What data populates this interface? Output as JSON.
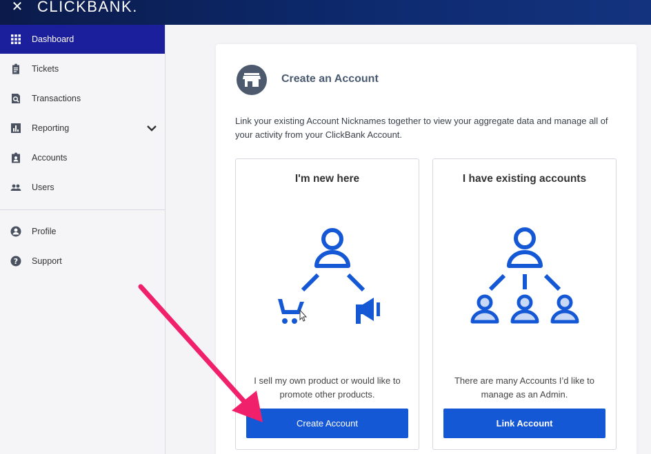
{
  "header": {
    "close_glyph": "✕",
    "brand": "CLICKBANK."
  },
  "sidebar": {
    "items": [
      {
        "label": "Dashboard",
        "icon": "grid-icon",
        "active": true
      },
      {
        "label": "Tickets",
        "icon": "clipboard-icon"
      },
      {
        "label": "Transactions",
        "icon": "receipt-search-icon"
      },
      {
        "label": "Reporting",
        "icon": "bar-chart-icon",
        "expandable": true
      },
      {
        "label": "Accounts",
        "icon": "account-badge-icon"
      },
      {
        "label": "Users",
        "icon": "users-icon"
      },
      {
        "label": "Profile",
        "icon": "person-circle-icon"
      },
      {
        "label": "Support",
        "icon": "help-circle-icon"
      }
    ]
  },
  "main": {
    "title": "Create an Account",
    "description": "Link your existing Account Nicknames together to view your aggregate data and manage all of your activity from your ClickBank Account.",
    "options": [
      {
        "title": "I'm new here",
        "text": "I sell my own product or would like to promote other products.",
        "button": "Create Account",
        "icon": "person-cart-megaphone-icon"
      },
      {
        "title": "I have existing accounts",
        "text": "There are many Accounts I’d like to manage as an Admin.",
        "button": "Link Account",
        "icon": "account-hierarchy-icon"
      }
    ]
  },
  "colors": {
    "topbar": "#0d2a6e",
    "active_nav": "#1b1f9c",
    "accent_blue": "#1558d6",
    "icon_gray": "#4d5a6e",
    "annotation_arrow": "#f0206a"
  }
}
